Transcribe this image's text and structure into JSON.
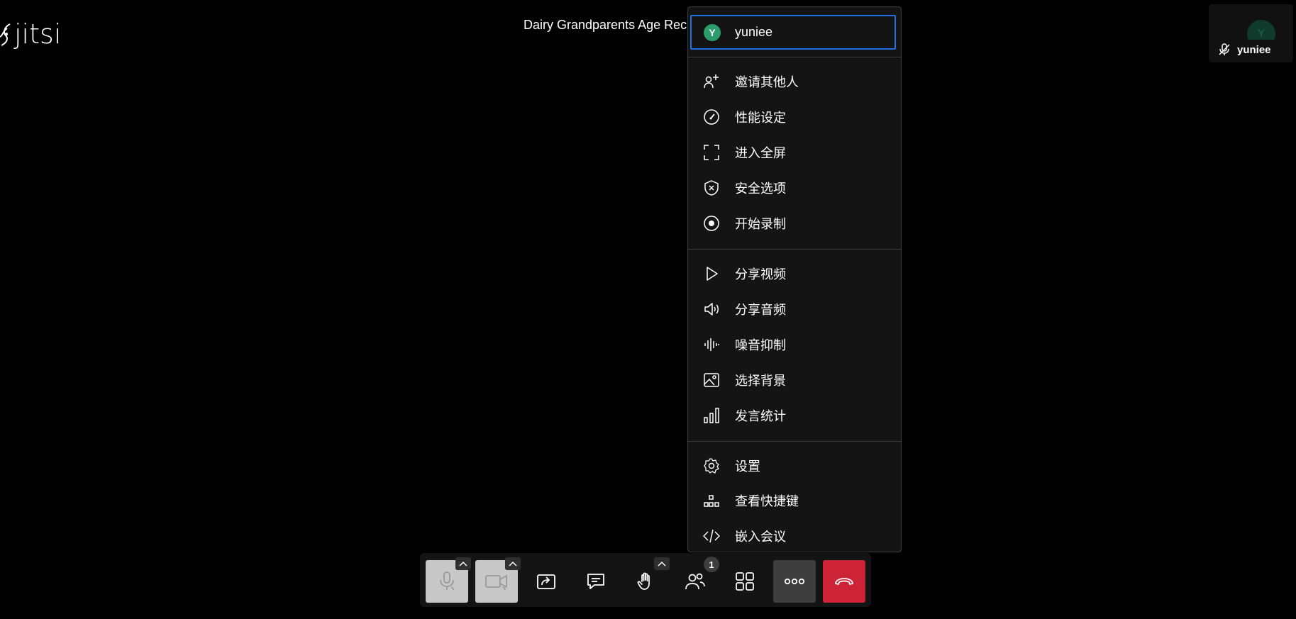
{
  "app": {
    "logo_text": "jitsi",
    "meeting_title": "Dairy Grandparents Age Reck"
  },
  "thumbnail": {
    "avatar_initial": "Y",
    "name": "yuniee",
    "mic_status_icon": "mic-muted-icon"
  },
  "menu": {
    "profile": {
      "avatar_initial": "Y",
      "name": "yuniee",
      "avatar_color": "#2a9d6a"
    },
    "items": [
      {
        "label": "邀请其他人",
        "icon": "add-user-icon"
      },
      {
        "label": "性能设定",
        "icon": "gauge-icon"
      },
      {
        "label": "进入全屏",
        "icon": "fullscreen-icon"
      },
      {
        "label": "安全选项",
        "icon": "shield-icon"
      },
      {
        "label": "开始录制",
        "icon": "record-icon"
      },
      {
        "label": "分享视频",
        "icon": "play-icon"
      },
      {
        "label": "分享音频",
        "icon": "speaker-icon"
      },
      {
        "label": "噪音抑制",
        "icon": "waveform-icon"
      },
      {
        "label": "选择背景",
        "icon": "image-icon"
      },
      {
        "label": "发言统计",
        "icon": "bar-chart-icon"
      },
      {
        "label": "设置",
        "icon": "gear-icon"
      },
      {
        "label": "查看快捷键",
        "icon": "keyboard-shortcuts-icon"
      },
      {
        "label": "嵌入会议",
        "icon": "code-icon"
      }
    ]
  },
  "toolbar": {
    "participants_count": "1",
    "buttons": [
      "microphone",
      "camera",
      "share-screen",
      "chat",
      "raise-hand",
      "participants",
      "tile-view",
      "more-options",
      "hangup"
    ]
  },
  "colors": {
    "accent_focus": "#246fe5",
    "hangup": "#cc2436",
    "menu_bg": "#141414"
  }
}
